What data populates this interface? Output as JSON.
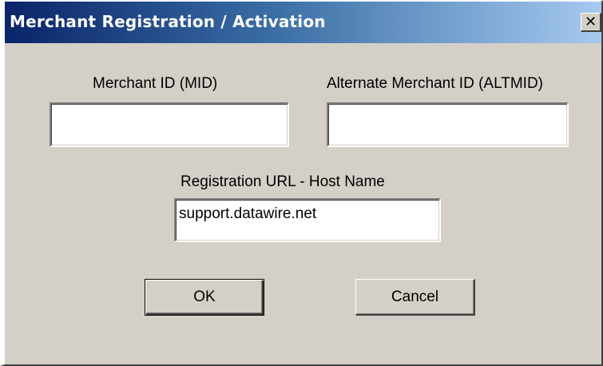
{
  "window": {
    "title": "Merchant Registration / Activation",
    "close_glyph": "✕",
    "close_icon": "close-icon"
  },
  "form": {
    "mid_label": "Merchant ID (MID)",
    "mid_value": "",
    "altmid_label": "Alternate Merchant ID (ALTMID)",
    "altmid_value": "",
    "url_label": "Registration URL - Host Name",
    "url_value": "support.datawire.net"
  },
  "buttons": {
    "ok_label": "OK",
    "cancel_label": "Cancel"
  }
}
